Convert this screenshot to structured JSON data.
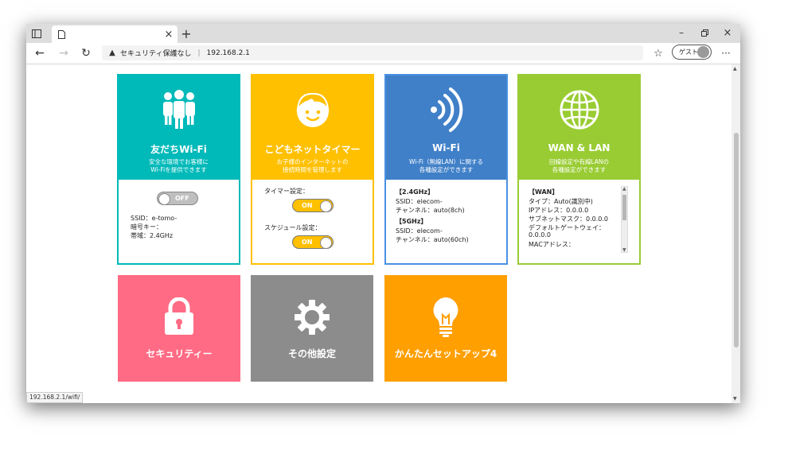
{
  "browser": {
    "address_warning": "セキュリティ保護なし",
    "url": "192.168.2.1",
    "guest_label": "ゲスト",
    "status_url": "192.168.2.1/wifi/"
  },
  "cards": {
    "friends_wifi": {
      "title": "友だちWi-Fi",
      "desc_line1": "安全な環境でお客様に",
      "desc_line2": "Wi-Fiを提供できます",
      "toggle_label": "OFF",
      "ssid": "SSID：e-tomo-",
      "password": "暗号キー：",
      "band": "帯域：2.4GHz",
      "color": "#00b9b9"
    },
    "kids_timer": {
      "title": "こどもネットタイマー",
      "desc_line1": "お子様のインターネットの",
      "desc_line2": "接続時間を管理します",
      "timer_label": "タイマー設定：",
      "timer_toggle": "ON",
      "schedule_label": "スケジュール設定：",
      "schedule_toggle": "ON",
      "color": "#ffc000"
    },
    "wifi": {
      "title": "Wi-Fi",
      "desc_line1": "Wi-Fi（無線LAN）に関する",
      "desc_line2": "各種設定ができます",
      "band24_header": "【2.4GHz】",
      "band24_ssid": "SSID：elecom-",
      "band24_channel": "チャンネル：auto(8ch)",
      "band5_header": "【5GHz】",
      "band5_ssid": "SSID：elecom-",
      "band5_channel": "チャンネル：auto(60ch)",
      "color": "#4080c8"
    },
    "wan_lan": {
      "title": "WAN & LAN",
      "desc_line1": "回線設定や有線LANの",
      "desc_line2": "各種設定ができます",
      "wan_header": "【WAN】",
      "type": "タイプ：Auto(識別中)",
      "ip": "IPアドレス：0.0.0.0",
      "subnet": "サブネットマスク：0.0.0.0",
      "gateway_label": "デフォルトゲートウェイ：",
      "gateway_value": "0.0.0.0",
      "mac": "MACアドレス：",
      "color": "#99cc33"
    }
  },
  "tiles": {
    "security": {
      "label": "セキュリティー",
      "color": "#ff6b84"
    },
    "other": {
      "label": "その他設定",
      "color": "#8c8c8c"
    },
    "easy_setup": {
      "label": "かんたんセットアップ4",
      "color": "#ff9f00"
    }
  },
  "icons": [
    "sidebar-icon",
    "tab-page-icon",
    "close-icon",
    "new-tab-icon",
    "back-icon",
    "forward-icon",
    "reload-icon",
    "warning-icon",
    "favorites-icon",
    "more-icon",
    "people-icon",
    "child-face-icon",
    "wifi-signal-icon",
    "globe-icon",
    "lock-icon",
    "gear-icon",
    "lightbulb-icon"
  ]
}
